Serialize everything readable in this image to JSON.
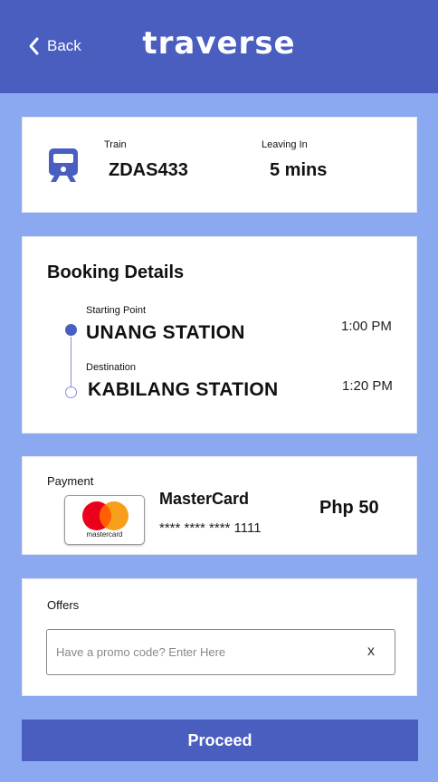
{
  "header": {
    "back_label": "Back",
    "logo_text": "traverse"
  },
  "train": {
    "train_label": "Train",
    "train_value": "ZDAS433",
    "leaving_label": "Leaving In",
    "leaving_value": "5 mins",
    "icon": "train-icon"
  },
  "booking": {
    "title": "Booking Details",
    "start_label": "Starting Point",
    "start_station": "UNANG STATION",
    "start_time": "1:00 PM",
    "dest_label": "Destination",
    "dest_station": "KABILANG STATION",
    "dest_time": "1:20 PM"
  },
  "payment": {
    "label": "Payment",
    "card_brand": "MasterCard",
    "card_logo_text": "mastercard",
    "card_number": "**** **** **** 1111",
    "amount": "Php 50"
  },
  "offers": {
    "label": "Offers",
    "promo_placeholder": "Have a promo code? Enter Here",
    "promo_value": "",
    "clear_label": "x"
  },
  "proceed_label": "Proceed",
  "colors": {
    "primary": "#4a5ec0",
    "background": "#8aa9f0",
    "mastercard_red": "#eb001b",
    "mastercard_orange": "#f79e1b"
  }
}
